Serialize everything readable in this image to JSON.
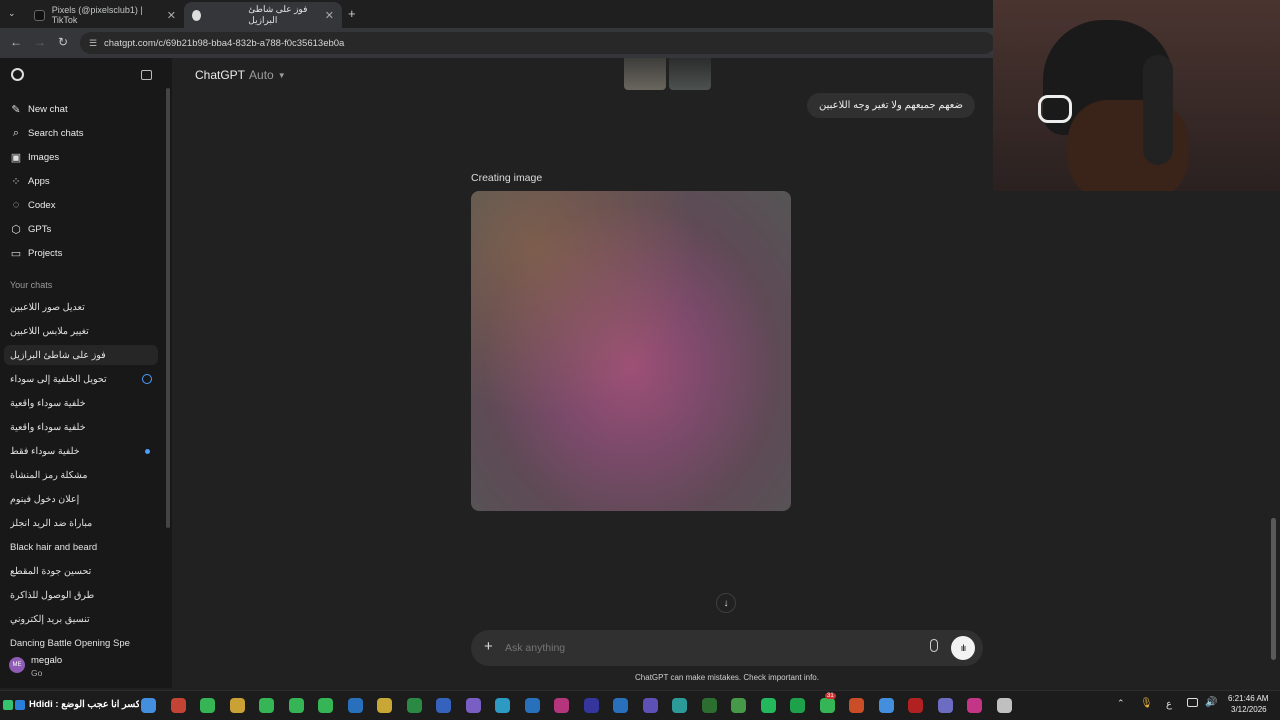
{
  "browser": {
    "tabs": [
      {
        "title": "Pixels (@pixelsclub1) | TikTok",
        "active": false
      },
      {
        "title": "فوز على شاطئ البرازيل",
        "active": true
      }
    ],
    "new_tab": "+",
    "url": "chatgpt.com/c/69b21b98-bba4-832b-a788-f0c35613eb0a"
  },
  "sidebar": {
    "nav": [
      {
        "label": "New chat",
        "icon": "new-chat-icon",
        "glyph": "✎"
      },
      {
        "label": "Search chats",
        "icon": "search-icon",
        "glyph": "⌕"
      },
      {
        "label": "Images",
        "icon": "images-icon",
        "glyph": "▣"
      },
      {
        "label": "Apps",
        "icon": "apps-icon",
        "glyph": "⁘"
      },
      {
        "label": "Codex",
        "icon": "codex-icon",
        "glyph": "◌"
      },
      {
        "label": "GPTs",
        "icon": "gpts-icon",
        "glyph": "⬡"
      },
      {
        "label": "Projects",
        "icon": "projects-icon",
        "glyph": "▭"
      }
    ],
    "section_title": "Your chats",
    "chats": [
      "تعديل صور اللاعبين",
      "تغيير ملابس اللاعبين",
      "فوز على شاطئ البرازيل",
      "تحويل الخلفية إلى سوداء",
      "خلفية سوداء واقعية",
      "خلفية سوداء واقعية",
      "خلفية سوداء فقط",
      "مشكلة رمز المنشأة",
      "إعلان دخول فينوم",
      "مباراة ضد الريد انجلز",
      "Black hair and beard",
      "تحسين جودة المقطع",
      "طرق الوصول للذاكرة",
      "تنسيق بريد إلكتروني",
      "Dancing Battle Opening Spe"
    ],
    "active_chat_index": 2,
    "user": {
      "initials": "ME",
      "name": "megalo",
      "plan": "Go"
    }
  },
  "header": {
    "title": "ChatGPT",
    "model": "Auto"
  },
  "conversation": {
    "user_message": "ضعهم جميعهم ولا تغير وجه اللاعبين",
    "status": "Creating image"
  },
  "composer": {
    "placeholder": "Ask anything",
    "disclaimer": "ChatGPT can make mistakes. Check important info."
  },
  "taskbar": {
    "ticker": "Hdidi :  الراوتر اكسر انا عجب الوضع",
    "time": "6:21:46 AM",
    "date": "3/12/2026",
    "lang": "ع",
    "badge_count": "31"
  },
  "colors": {
    "accent_blue": "#4a9eff",
    "background": "#212121",
    "sidebar": "#181818"
  }
}
